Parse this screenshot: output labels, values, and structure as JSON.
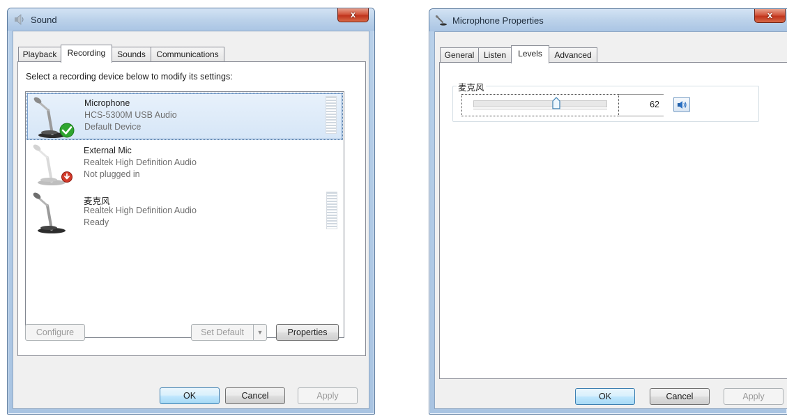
{
  "sound_dialog": {
    "title": "Sound",
    "close_glyph": "x",
    "tabs": [
      {
        "label": "Playback"
      },
      {
        "label": "Recording",
        "active": true
      },
      {
        "label": "Sounds"
      },
      {
        "label": "Communications"
      }
    ],
    "instruction": "Select a recording device below to modify its settings:",
    "devices": [
      {
        "name": "Microphone",
        "description": "HCS-5300M USB Audio",
        "status": "Default Device",
        "badge": "check-icon",
        "selected": true
      },
      {
        "name": "External Mic",
        "description": "Realtek High Definition Audio",
        "status": "Not plugged in",
        "badge": "unplugged-icon",
        "selected": false
      },
      {
        "name": "麦克风",
        "description": "Realtek High Definition Audio",
        "status": "Ready",
        "badge": "",
        "selected": false
      }
    ],
    "buttons": {
      "configure": "Configure",
      "set_default": "Set Default",
      "properties": "Properties",
      "ok": "OK",
      "cancel": "Cancel",
      "apply": "Apply"
    }
  },
  "properties_dialog": {
    "title": "Microphone Properties",
    "close_glyph": "x",
    "tabs": [
      {
        "label": "General"
      },
      {
        "label": "Listen"
      },
      {
        "label": "Levels",
        "active": true
      },
      {
        "label": "Advanced"
      }
    ],
    "level": {
      "label": "麦克风",
      "value": "62",
      "slider_fraction": 0.62
    },
    "buttons": {
      "ok": "OK",
      "cancel": "Cancel",
      "apply": "Apply"
    }
  },
  "colors": {
    "accent": "#3c7fb1",
    "status_ok": "#2fa52f",
    "status_unplugged": "#d23a2a"
  }
}
